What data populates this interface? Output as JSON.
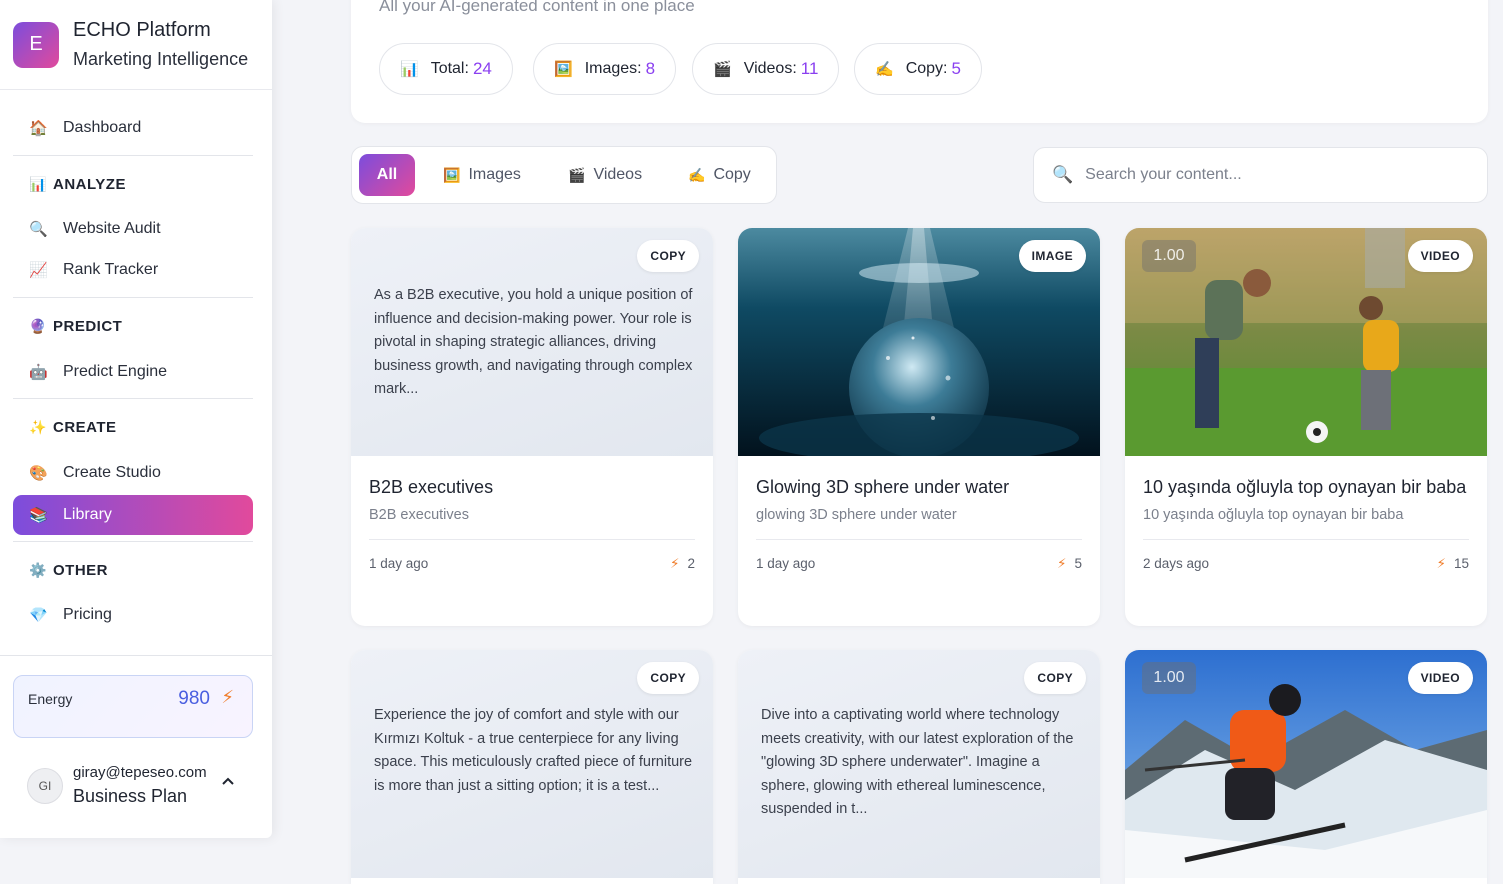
{
  "brand": {
    "logo_letter": "E",
    "title": "ECHO Platform",
    "subtitle": "Marketing Intelligence"
  },
  "sidebar": {
    "dashboard": {
      "icon": "🏠",
      "label": "Dashboard"
    },
    "sections": [
      {
        "icon": "📊",
        "label": "ANALYZE",
        "items": [
          {
            "icon": "🔍",
            "label": "Website Audit"
          },
          {
            "icon": "📈",
            "label": "Rank Tracker"
          }
        ]
      },
      {
        "icon": "🔮",
        "label": "PREDICT",
        "items": [
          {
            "icon": "🤖",
            "label": "Predict Engine"
          }
        ]
      },
      {
        "icon": "✨",
        "label": "CREATE",
        "items": [
          {
            "icon": "🎨",
            "label": "Create Studio"
          },
          {
            "icon": "📚",
            "label": "Library"
          }
        ]
      },
      {
        "icon": "⚙️",
        "label": "OTHER",
        "items": [
          {
            "icon": "💎",
            "label": "Pricing"
          }
        ]
      }
    ],
    "active_item": "Library"
  },
  "energy": {
    "label": "Energy",
    "value": "980",
    "icon": "⚡"
  },
  "user": {
    "initials": "GI",
    "email": "giray@tepeseo.com",
    "plan": "Business Plan",
    "chevron": "^"
  },
  "header": {
    "subtitle": "All your AI-generated content in one place",
    "stats": [
      {
        "icon": "📊",
        "label": "Total:",
        "value": "24"
      },
      {
        "icon": "🖼️",
        "label": "Images:",
        "value": "8"
      },
      {
        "icon": "🎬",
        "label": "Videos:",
        "value": "11"
      },
      {
        "icon": "✍️",
        "label": "Copy:",
        "value": "5"
      }
    ]
  },
  "filters": {
    "tabs": [
      {
        "label": "All",
        "icon": ""
      },
      {
        "label": "Images",
        "icon": "🖼️"
      },
      {
        "label": "Videos",
        "icon": "🎬"
      },
      {
        "label": "Copy",
        "icon": "✍️"
      }
    ],
    "active": "All"
  },
  "search": {
    "icon": "🔍",
    "placeholder": "Search your content..."
  },
  "colors": {
    "accent_start": "#7c4ddc",
    "accent_end": "#e14a9c",
    "stat_value": "#8a3ff0",
    "energy_value": "#4a5ee0",
    "bolt": "#f07d2b"
  },
  "cards": [
    {
      "type": "COPY",
      "preview": "As a B2B executive, you hold a unique position of influence and decision-making power. Your role is pivotal in shaping strategic alliances, driving business growth, and navigating through complex mark...",
      "title": "B2B executives",
      "desc": "B2B executives",
      "time": "1 day ago",
      "credits": "2"
    },
    {
      "type": "IMAGE",
      "image": "glowing-sphere-underwater",
      "title": "Glowing 3D sphere under water",
      "desc": "glowing 3D sphere under water",
      "time": "1 day ago",
      "credits": "5"
    },
    {
      "type": "VIDEO",
      "image": "father-son-soccer",
      "timecode": "1.00",
      "title": "10 yaşında oğluyla top oynayan bir baba",
      "desc": "10 yaşında oğluyla top oynayan bir baba",
      "time": "2 days ago",
      "credits": "15"
    },
    {
      "type": "COPY",
      "preview": "Experience the joy of comfort and style with our Kırmızı Koltuk - a true centerpiece for any living space. This meticulously crafted piece of furniture is more than just a sitting option; it is a test..."
    },
    {
      "type": "COPY",
      "preview": "Dive into a captivating world where technology meets creativity, with our latest exploration of the \"glowing 3D sphere underwater\". Imagine a sphere, glowing with ethereal luminescence, suspended in t..."
    },
    {
      "type": "VIDEO",
      "image": "skier-mountain",
      "timecode": "1.00"
    }
  ]
}
